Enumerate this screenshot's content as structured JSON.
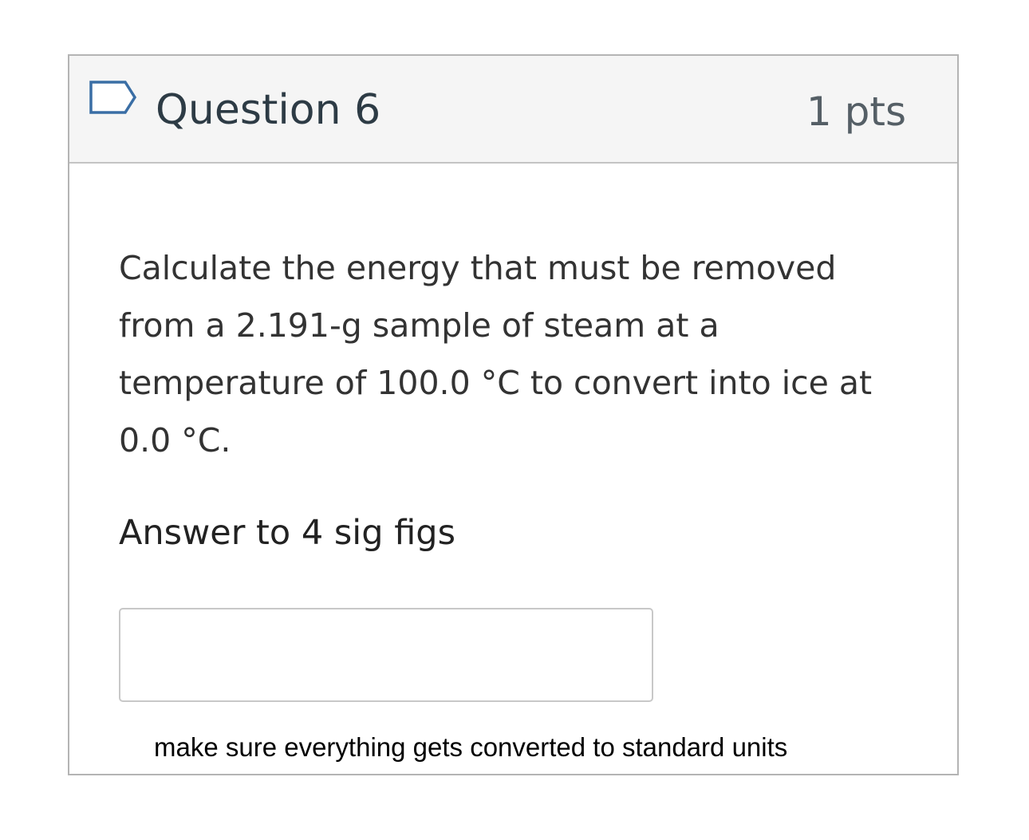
{
  "question": {
    "title": "Question 6",
    "points": "1 pts",
    "flag_icon": "flag-outline-icon",
    "text": "Calculate the energy that must be removed from a 2.191-g sample of steam at a temperature of 100.0 °C to convert into ice at 0.0 °C.",
    "instruction": "Answer to 4 sig figs",
    "answer_value": "",
    "answer_placeholder": ""
  },
  "note": "make sure everything gets converted to standard units",
  "colors": {
    "header_bg": "#f5f5f5",
    "border": "#b4b4b4",
    "flag_stroke": "#3a6ea5",
    "title_text": "#2d3b45",
    "body_text": "#333333"
  }
}
